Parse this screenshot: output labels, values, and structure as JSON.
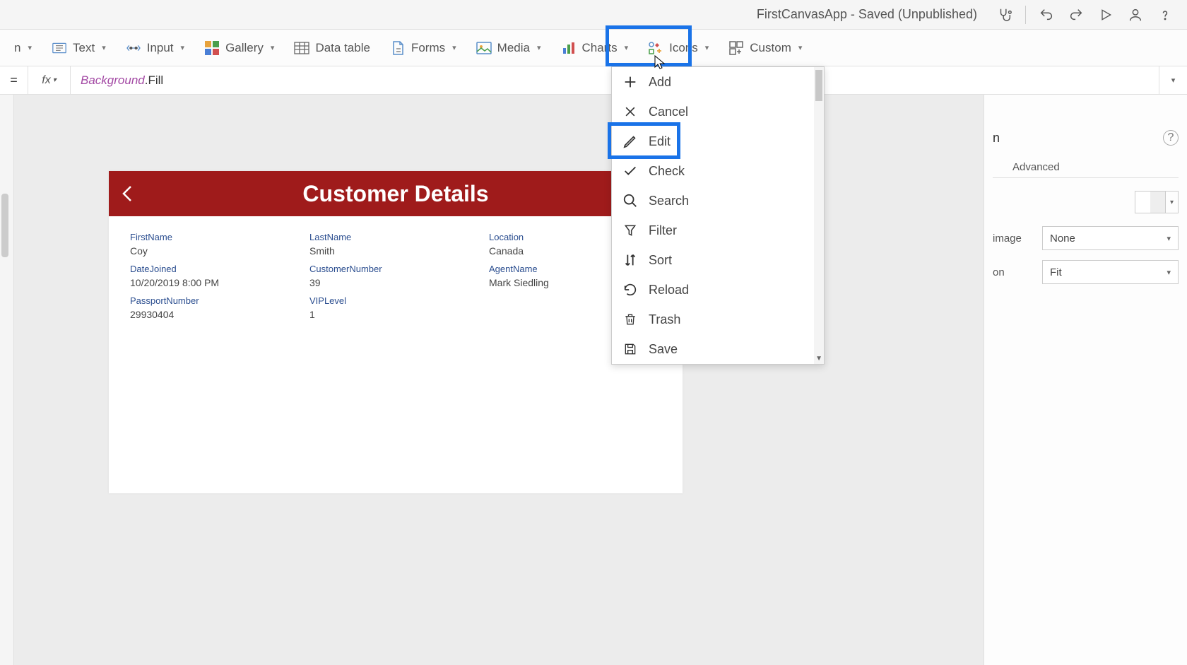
{
  "title": "FirstCanvasApp - Saved (Unpublished)",
  "ribbon": {
    "text": "Text",
    "input": "Input",
    "gallery": "Gallery",
    "datatable": "Data table",
    "forms": "Forms",
    "media": "Media",
    "charts": "Charts",
    "icons": "Icons",
    "custom": "Custom"
  },
  "formula": {
    "eq": "=",
    "fx": "fx",
    "prop": "Background",
    "rest": ".Fill"
  },
  "canvas": {
    "title": "Customer Details",
    "fields": [
      {
        "label": "FirstName",
        "value": "Coy"
      },
      {
        "label": "LastName",
        "value": "Smith"
      },
      {
        "label": "Location",
        "value": "Canada"
      },
      {
        "label": "DateJoined",
        "value": "10/20/2019 8:00 PM"
      },
      {
        "label": "CustomerNumber",
        "value": "39"
      },
      {
        "label": "AgentName",
        "value": "Mark Siedling"
      },
      {
        "label": "PassportNumber",
        "value": "29930404"
      },
      {
        "label": "VIPLevel",
        "value": "1"
      }
    ]
  },
  "dd": {
    "add": "Add",
    "cancel": "Cancel",
    "edit": "Edit",
    "check": "Check",
    "search": "Search",
    "filter": "Filter",
    "sort": "Sort",
    "reload": "Reload",
    "trash": "Trash",
    "save": "Save"
  },
  "rp": {
    "title": "n",
    "tab_props": "",
    "tab_adv": "Advanced",
    "image_label": "image",
    "image_value": "None",
    "pos_label": "on",
    "pos_value": "Fit"
  }
}
